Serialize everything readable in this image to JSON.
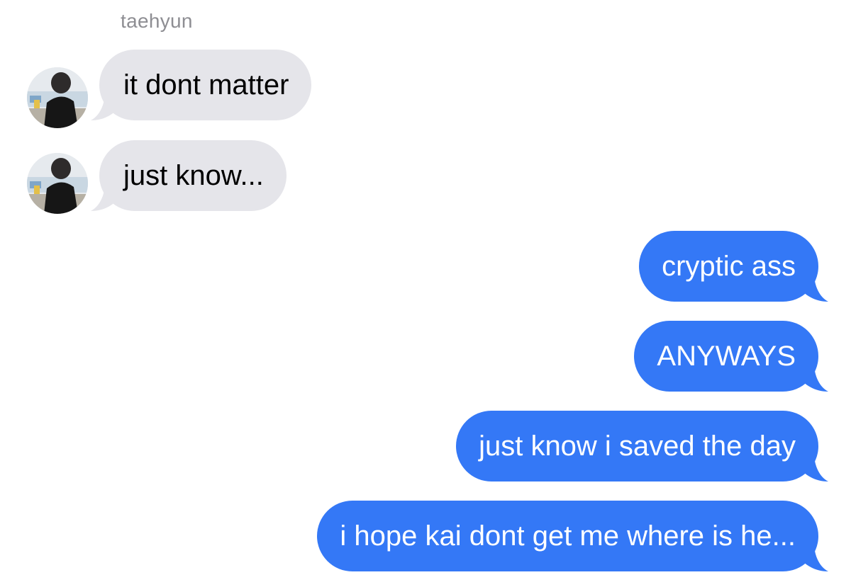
{
  "conversation": {
    "sender_name": "taehyun",
    "colors": {
      "incoming_bubble": "#e5e5ea",
      "outgoing_bubble": "#3478f6",
      "incoming_text": "#000000",
      "outgoing_text": "#ffffff",
      "sender_name": "#8e8e93"
    },
    "messages": [
      {
        "direction": "incoming",
        "text": "it dont matter",
        "has_avatar": true
      },
      {
        "direction": "incoming",
        "text": "just know...",
        "has_avatar": true
      },
      {
        "direction": "outgoing",
        "text": "cryptic ass"
      },
      {
        "direction": "outgoing",
        "text": "ANYWAYS"
      },
      {
        "direction": "outgoing",
        "text": "just know i saved the day"
      },
      {
        "direction": "outgoing",
        "text": "i hope kai dont get me where is he..."
      }
    ]
  }
}
